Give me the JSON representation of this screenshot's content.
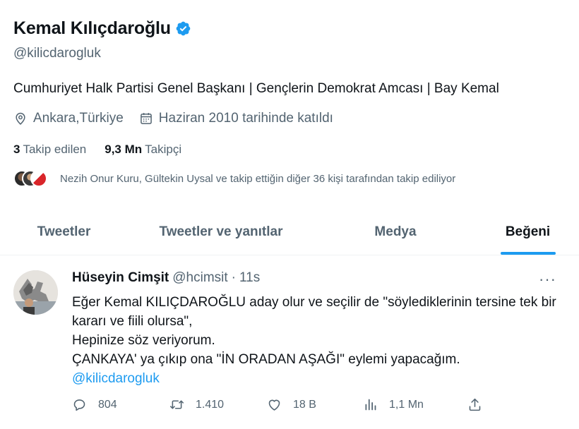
{
  "profile": {
    "display_name": "Kemal Kılıçdaroğlu",
    "handle": "@kilicdarogluk",
    "bio": "Cumhuriyet Halk Partisi Genel Başkanı | Gençlerin Demokrat Amcası | Bay Kemal",
    "location": "Ankara,Türkiye",
    "joined": "Haziran 2010 tarihinde katıldı",
    "following_count": "3",
    "following_label": "Takip edilen",
    "followers_count": "9,3 Mn",
    "followers_label": "Takipçi",
    "followed_by": "Nezih Onur Kuru, Gültekin Uysal ve takip ettiğin diğer 36 kişi tarafından takip ediliyor",
    "verified_icon": "verified-badge-icon",
    "accent_color": "#1d9bf0"
  },
  "tabs": [
    {
      "label": "Tweetler",
      "active": false
    },
    {
      "label": "Tweetler ve yanıtlar",
      "active": false
    },
    {
      "label": "Medya",
      "active": false
    },
    {
      "label": "Beğeni",
      "active": true
    }
  ],
  "tweet": {
    "author": "Hüseyin Cimşit",
    "handle": "@hcimsit",
    "separator": "·",
    "time": "11s",
    "text": "Eğer Kemal KILIÇDAROĞLU aday olur ve seçilir de \"söylediklerinin tersine tek bir kararı ve fiili olursa\",\nHepinize söz veriyorum.\nÇANKAYA' ya çıkıp ona \"İN ORADAN AŞAĞI\" eylemi yapacağım.",
    "mention": "@kilicdarogluk",
    "more": "···",
    "replies": "804",
    "retweets": "1.410",
    "likes": "18 B",
    "views": "1,1 Mn"
  }
}
